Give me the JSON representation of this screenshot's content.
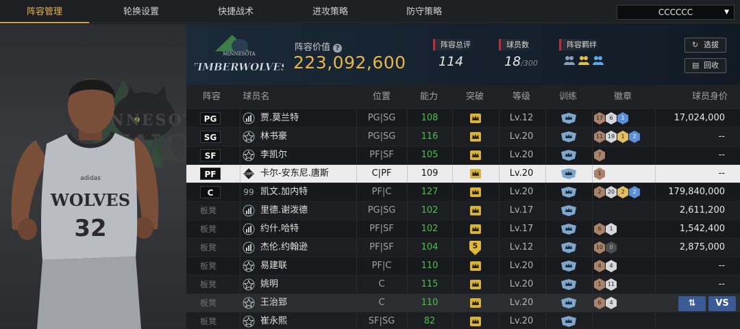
{
  "nav": {
    "tabs": [
      "阵容管理",
      "轮换设置",
      "快捷战术",
      "进攻策略",
      "防守策略"
    ],
    "active_tab": "阵容管理",
    "team_select": "CCCCCC"
  },
  "header": {
    "value_label": "阵容价值",
    "value_help": "?",
    "value": "223,092,600",
    "overall_label": "阵容总评",
    "overall": "114",
    "players_label": "球员数",
    "players_count": "18",
    "players_max": "/300",
    "bond_label": "阵容羁绊",
    "team_logo_text_top": "MINNESOTA",
    "team_logo_text": "TIMBERWOLVES",
    "btn_pick": "选拔",
    "btn_recycle": "回收"
  },
  "columns": [
    "阵容",
    "球员名",
    "位置",
    "能力",
    "突破",
    "等级",
    "训练",
    "徽章",
    "球员身价"
  ],
  "rows": [
    {
      "slot": "PG",
      "starter": true,
      "type": "bar",
      "name": "贾.莫兰特",
      "pos": "PG|SG",
      "ability": "108",
      "level": "Lv.12",
      "badges": [
        [
          "17",
          "b-bronze"
        ],
        [
          "6",
          "b-silver"
        ],
        [
          "1",
          "b-blue"
        ]
      ],
      "value": "17,024,000"
    },
    {
      "slot": "SG",
      "starter": true,
      "type": "star",
      "name": "林书豪",
      "pos": "PG|SG",
      "ability": "116",
      "level": "Lv.20",
      "badges": [
        [
          "11",
          "b-bronze"
        ],
        [
          "19",
          "b-silver"
        ],
        [
          "1",
          "b-gold"
        ],
        [
          "2",
          "b-blue"
        ]
      ],
      "value": "--"
    },
    {
      "slot": "SF",
      "starter": true,
      "type": "star",
      "name": "李凯尔",
      "pos": "PF|SF",
      "ability": "105",
      "level": "Lv.20",
      "badges": [
        [
          "7",
          "b-bronze"
        ]
      ],
      "value": "--"
    },
    {
      "slot": "PF",
      "starter": true,
      "type": "copy",
      "name": "卡尔-安东尼.唐斯",
      "pos": "C|PF",
      "ability": "109",
      "level": "Lv.20",
      "badges": [
        [
          "1",
          "b-bronze"
        ]
      ],
      "value": "--",
      "selected": true
    },
    {
      "slot": "C",
      "starter": true,
      "type": "99",
      "name": "凯文.加内特",
      "pos": "PF|C",
      "ability": "127",
      "level": "Lv.20",
      "badges": [
        [
          "2",
          "b-bronze"
        ],
        [
          "20",
          "b-silver"
        ],
        [
          "2",
          "b-gold"
        ],
        [
          "2",
          "b-blue"
        ]
      ],
      "value": "179,840,000"
    },
    {
      "slot": "板凳",
      "starter": false,
      "type": "bar",
      "name": "里德.谢泼德",
      "pos": "PG|SG",
      "ability": "102",
      "level": "Lv.17",
      "badges": [],
      "value": "2,611,200"
    },
    {
      "slot": "板凳",
      "starter": false,
      "type": "bar",
      "name": "约什.哈特",
      "pos": "PF|SF",
      "ability": "102",
      "level": "Lv.17",
      "badges": [
        [
          "6",
          "b-bronze"
        ],
        [
          "1",
          "b-silver"
        ]
      ],
      "value": "1,542,400"
    },
    {
      "slot": "板凳",
      "starter": false,
      "type": "bar",
      "name": "杰伦.约翰逊",
      "pos": "PF|SF",
      "ability": "104",
      "level": "Lv.12",
      "badges": [
        [
          "10",
          "b-bronze"
        ],
        [
          "0",
          "b-dark"
        ]
      ],
      "value": "2,875,000",
      "crown5": "5"
    },
    {
      "slot": "板凳",
      "starter": false,
      "type": "star",
      "name": "易建联",
      "pos": "PF|C",
      "ability": "110",
      "level": "Lv.20",
      "badges": [
        [
          "4",
          "b-bronze"
        ],
        [
          "4",
          "b-silver"
        ]
      ],
      "value": "--"
    },
    {
      "slot": "板凳",
      "starter": false,
      "type": "star",
      "name": "姚明",
      "pos": "C",
      "ability": "115",
      "level": "Lv.20",
      "badges": [
        [
          "1",
          "b-bronze"
        ],
        [
          "11",
          "b-silver"
        ]
      ],
      "value": "--"
    },
    {
      "slot": "板凳",
      "starter": false,
      "type": "star",
      "name": "王治郅",
      "pos": "C",
      "ability": "110",
      "level": "Lv.20",
      "badges": [
        [
          "6",
          "b-bronze"
        ],
        [
          "4",
          "b-silver"
        ]
      ],
      "value": "",
      "hover": true
    },
    {
      "slot": "板凳",
      "starter": false,
      "type": "star",
      "name": "崔永熙",
      "pos": "SF|SG",
      "ability": "82",
      "level": "Lv.20",
      "badges": [],
      "value": ""
    }
  ],
  "row_actions": {
    "swap": "⇅",
    "vs": "VS"
  },
  "player": {
    "jersey_team": "WOLVES",
    "jersey_number": "32",
    "brand": "adidas",
    "bg_text_top": "MINNESOTA",
    "bg_text": "WOLVES"
  }
}
